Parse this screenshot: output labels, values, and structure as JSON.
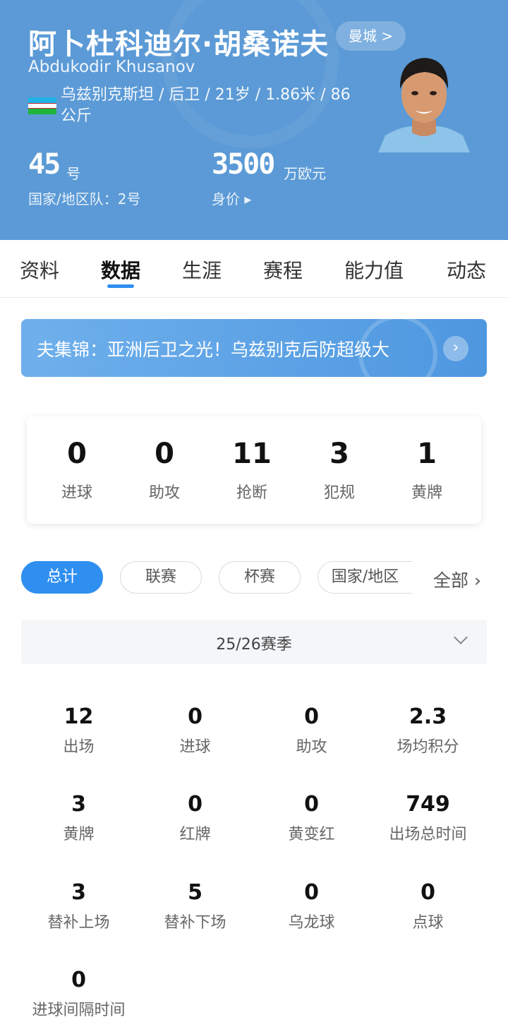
{
  "player": {
    "name_cn": "阿卜杜科迪尔·胡桑诺夫",
    "name_en": "Abdukodir Khusanov",
    "club_button": "曼城 >",
    "meta_line1": "乌兹别克斯坦 / 后卫 / 21岁 / 1.86米 / 86",
    "meta_line2": "公斤",
    "number": "45",
    "number_unit": "号",
    "national_team": "国家/地区队：2号",
    "value": "3500",
    "value_unit": "万欧元",
    "value_label": "身价 ▸"
  },
  "tabs": [
    "资料",
    "数据",
    "生涯",
    "赛程",
    "能力值",
    "动态"
  ],
  "banner": {
    "text": "夫集锦：亚洲后卫之光！乌兹别克后防超级大",
    "arrow": "›"
  },
  "summary": [
    {
      "value": "0",
      "label": "进球"
    },
    {
      "value": "0",
      "label": "助攻"
    },
    {
      "value": "11",
      "label": "抢断"
    },
    {
      "value": "3",
      "label": "犯规"
    },
    {
      "value": "1",
      "label": "黄牌"
    }
  ],
  "filters": [
    "总计",
    "联赛",
    "杯赛",
    "国家/地区"
  ],
  "filter_all": "全部 ›",
  "season": "25/26赛季",
  "stats": [
    {
      "value": "12",
      "label": "出场"
    },
    {
      "value": "0",
      "label": "进球"
    },
    {
      "value": "0",
      "label": "助攻"
    },
    {
      "value": "2.3",
      "label": "场均积分"
    },
    {
      "value": "3",
      "label": "黄牌"
    },
    {
      "value": "0",
      "label": "红牌"
    },
    {
      "value": "0",
      "label": "黄变红"
    },
    {
      "value": "749",
      "label": "出场总时间"
    },
    {
      "value": "3",
      "label": "替补上场"
    },
    {
      "value": "5",
      "label": "替补下场"
    },
    {
      "value": "0",
      "label": "乌龙球"
    },
    {
      "value": "0",
      "label": "点球"
    },
    {
      "value": "0",
      "label": "进球间隔时间"
    }
  ],
  "colors": {
    "header_bg": "#5b9ad6",
    "accent": "#2f8ff0"
  }
}
